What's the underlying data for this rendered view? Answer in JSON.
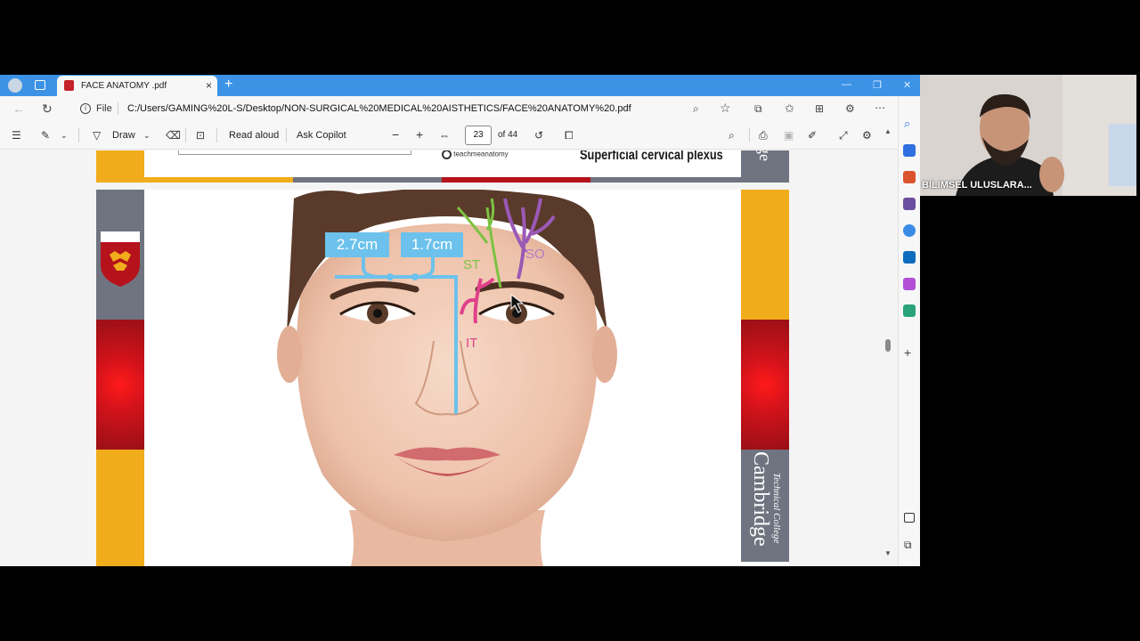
{
  "browser": {
    "tab_title": "FACE ANATOMY .pdf",
    "tab_close": "×",
    "new_tab": "+",
    "window_controls": [
      "—",
      "❐",
      "✕"
    ],
    "file_label": "File",
    "url": "C:/Users/GAMING%20L-S/Desktop/NON-SURGICAL%20MEDICAL%20AISTHETICS/FACE%20ANATOMY%20.pdf",
    "accent_color": "#3c93e6"
  },
  "pdf_toolbar": {
    "draw_label": "Draw",
    "read_aloud_label": "Read aloud",
    "ask_copilot_label": "Ask Copilot",
    "current_page": "23",
    "page_total": "of 44",
    "zoom_out": "−",
    "zoom_in": "+"
  },
  "slide_top": {
    "heading": "Superficial cervical plexus",
    "logo_text": "teachmeanatomy",
    "side_text": "ge"
  },
  "slide_main": {
    "measure_left": "2.7cm",
    "measure_right": "1.7cm",
    "label_st": "ST",
    "label_so": "SO",
    "label_it": "IT",
    "college_name": "Cambridge",
    "college_sub": "Technical College",
    "colors": {
      "gold": "#f1ac1c",
      "grey": "#6f7480",
      "red": "#b5121b",
      "measure_blue": "#6cc2ec",
      "st_green": "#7cc242",
      "so_purple": "#9b59b6",
      "it_pink": "#e0408a"
    }
  },
  "webcam": {
    "participant_name": "BILIMSEL ULUSLARA..."
  }
}
